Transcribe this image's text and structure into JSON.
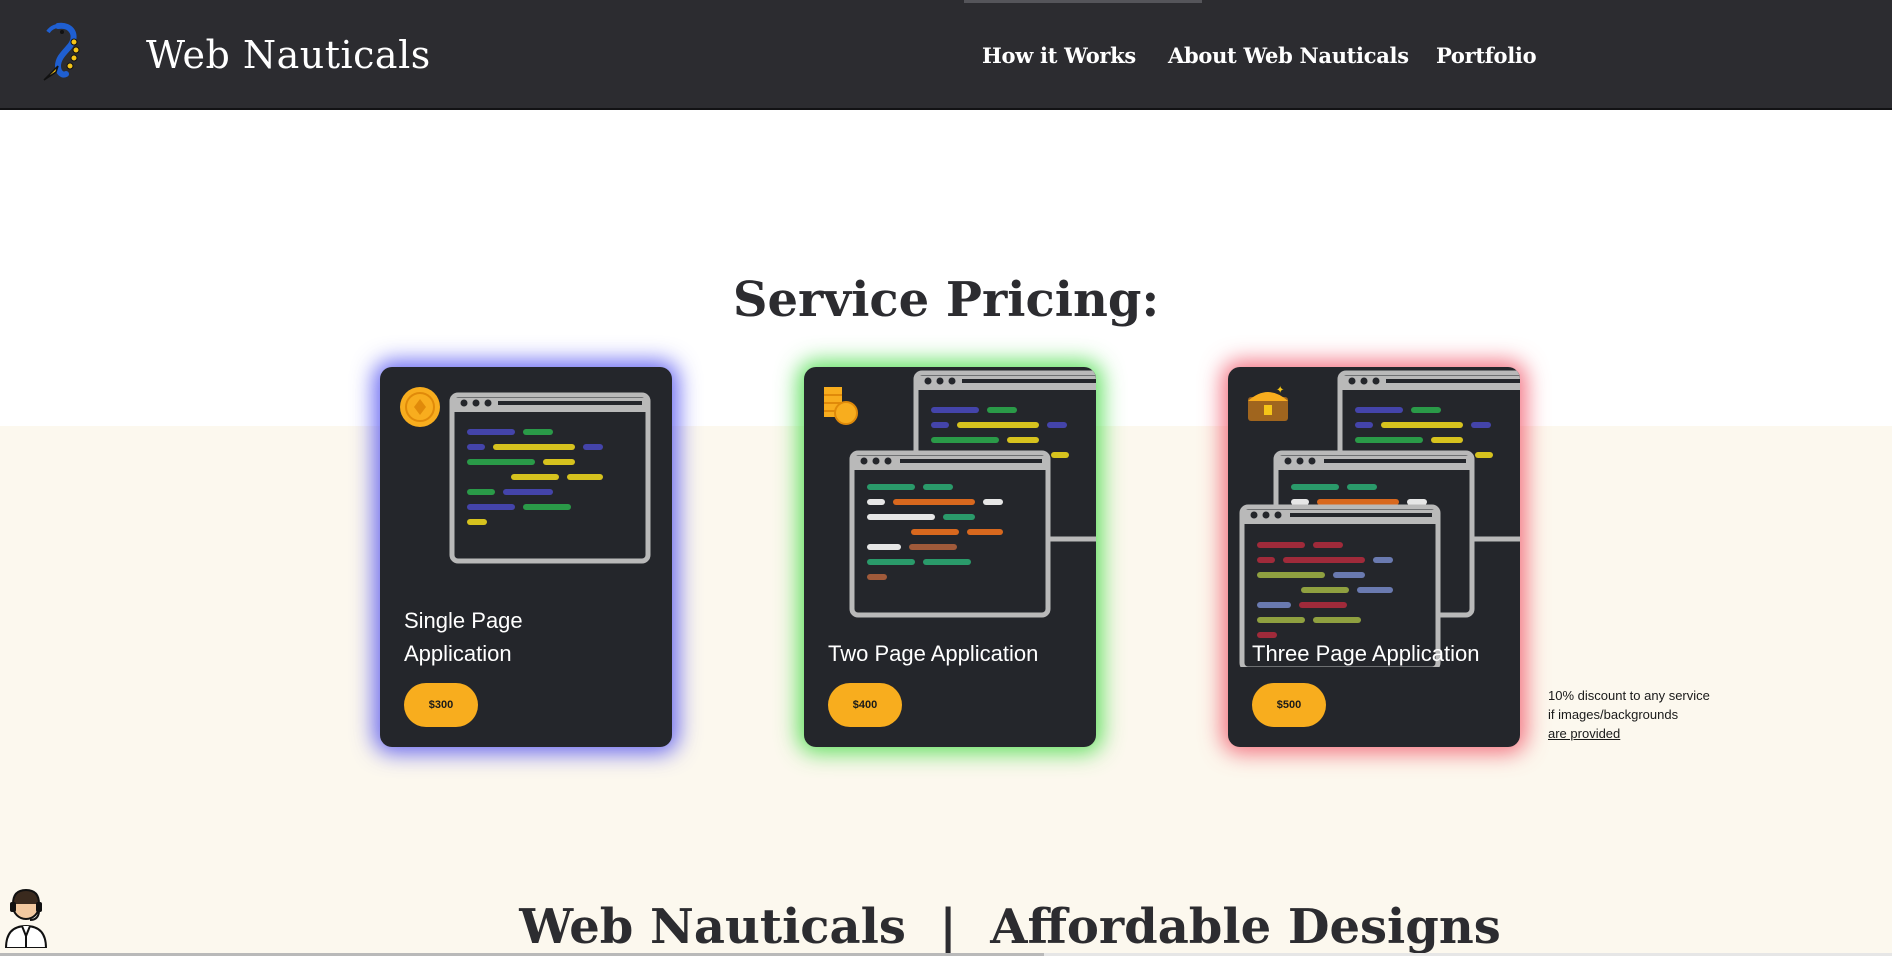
{
  "header": {
    "brand": "Web Nauticals",
    "nav": [
      {
        "label": "How it Works"
      },
      {
        "label": "About Web Nauticals"
      },
      {
        "label": "Portfolio"
      }
    ]
  },
  "pricing": {
    "title": "Service Pricing:",
    "cards": [
      {
        "title": "Single Page Application",
        "price": "$300",
        "glow": "#4e4ef0",
        "icon": "gold-coin-icon"
      },
      {
        "title": "Two Page Application",
        "price": "$400",
        "glow": "#48dc48",
        "icon": "coin-stack-icon"
      },
      {
        "title": "Three Page Application",
        "price": "$500",
        "glow": "#f05064",
        "icon": "treasure-chest-icon"
      }
    ],
    "discount": {
      "line1": "10% discount to any service",
      "line2": "if images/backgrounds",
      "link": "are provided"
    }
  },
  "tagline": {
    "title": "Web Nauticals  |  Affordable Designs"
  },
  "colors": {
    "header_bg": "#2c2c30",
    "card_bg": "#24262b",
    "price_button": "#f8ad1e",
    "section_bg": "#fcf8ee"
  }
}
